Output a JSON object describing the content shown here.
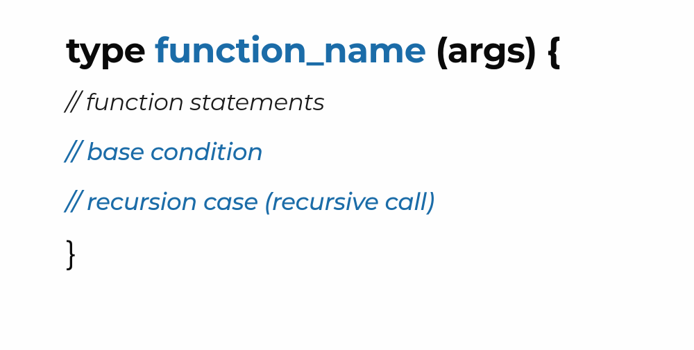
{
  "signature": {
    "type_keyword": "type ",
    "function_name": "function_name",
    "args_suffix": " (args) {"
  },
  "comments": {
    "statements": "// function statements",
    "base_condition": "// base condition",
    "recursion_case": "// recursion case (recursive call)"
  },
  "closing": "}"
}
